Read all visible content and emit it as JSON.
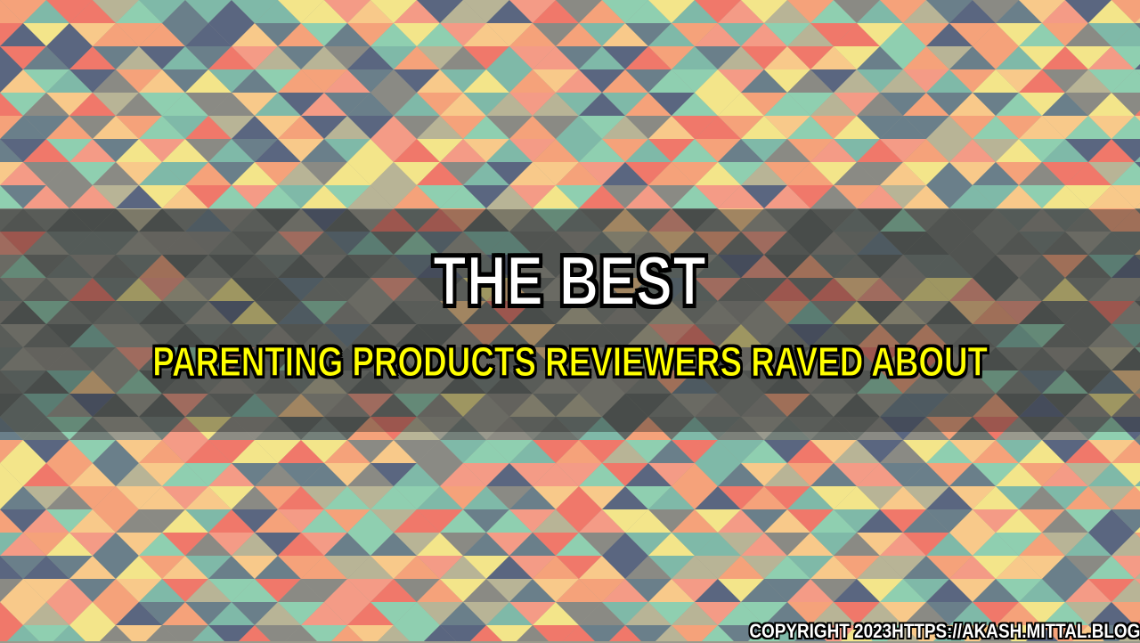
{
  "title": "THE BEST",
  "subtitle": "PARENTING PRODUCTS REVIEWERS RAVED ABOUT",
  "copyright": "COPYRIGHT 2023HTTPS://AKASH.MITTAL.BLOG/",
  "colors": {
    "title": "#ffffff",
    "subtitle": "#ffff00",
    "outline": "#000000",
    "palette": [
      "#f5a27a",
      "#f8c98a",
      "#f3e58a",
      "#8fcfb0",
      "#7fb9a8",
      "#6a7f8a",
      "#8a8a84",
      "#f0786a",
      "#f49b86",
      "#5a6680",
      "#b8b496"
    ]
  }
}
